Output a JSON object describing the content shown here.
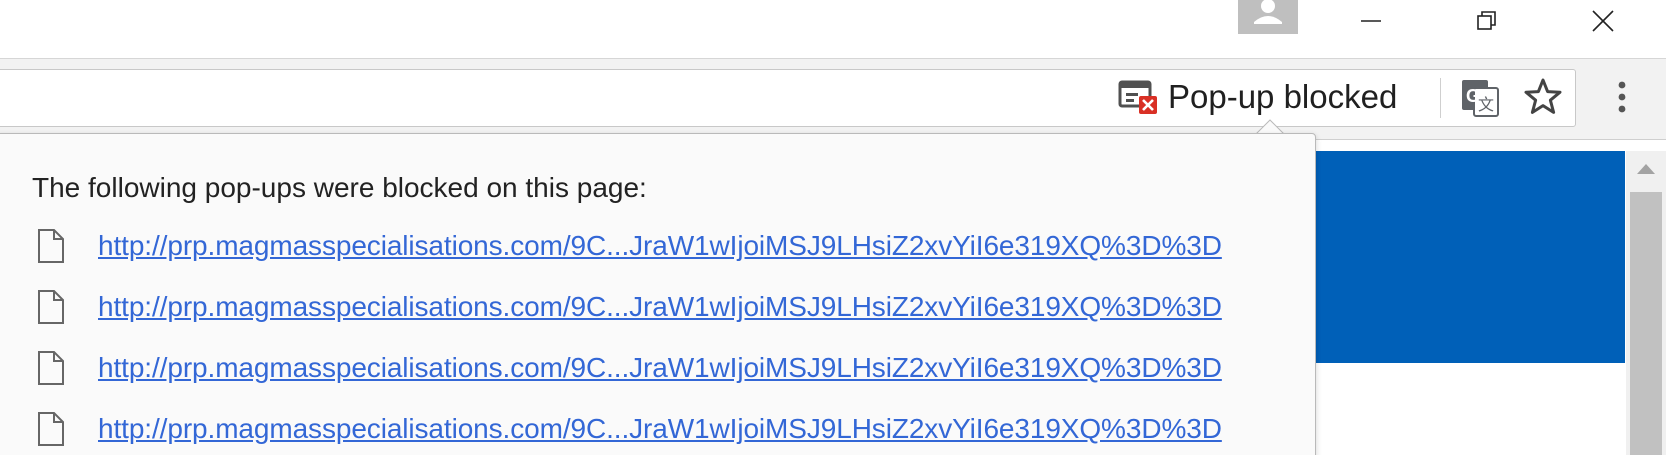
{
  "titlebar": {
    "avatar_icon": "person-icon",
    "minimize_icon": "minimize-icon",
    "restore_icon": "restore-icon",
    "close_icon": "close-icon"
  },
  "toolbar": {
    "popup_blocked_label": "Pop-up blocked",
    "popup_blocked_icon": "popup-blocked-icon",
    "translate_icon": "translate-icon",
    "bookmark_icon": "star-icon",
    "menu_icon": "more-vertical-icon"
  },
  "bubble": {
    "title": "The following pop-ups were blocked on this page:",
    "items": [
      {
        "url": "http://prp.magmasspecialisations.com/9C...JraW1wIjoiMSJ9LHsiZ2xvYiI6e319XQ%3D%3D",
        "icon": "file-icon"
      },
      {
        "url": "http://prp.magmasspecialisations.com/9C...JraW1wIjoiMSJ9LHsiZ2xvYiI6e319XQ%3D%3D",
        "icon": "file-icon"
      },
      {
        "url": "http://prp.magmasspecialisations.com/9C...JraW1wIjoiMSJ9LHsiZ2xvYiI6e319XQ%3D%3D",
        "icon": "file-icon"
      },
      {
        "url": "http://prp.magmasspecialisations.com/9C...JraW1wIjoiMSJ9LHsiZ2xvYiI6e319XQ%3D%3D",
        "icon": "file-icon"
      }
    ]
  },
  "colors": {
    "link": "#3367d6",
    "banner": "#0060b8",
    "blocked_badge": "#d93025"
  }
}
